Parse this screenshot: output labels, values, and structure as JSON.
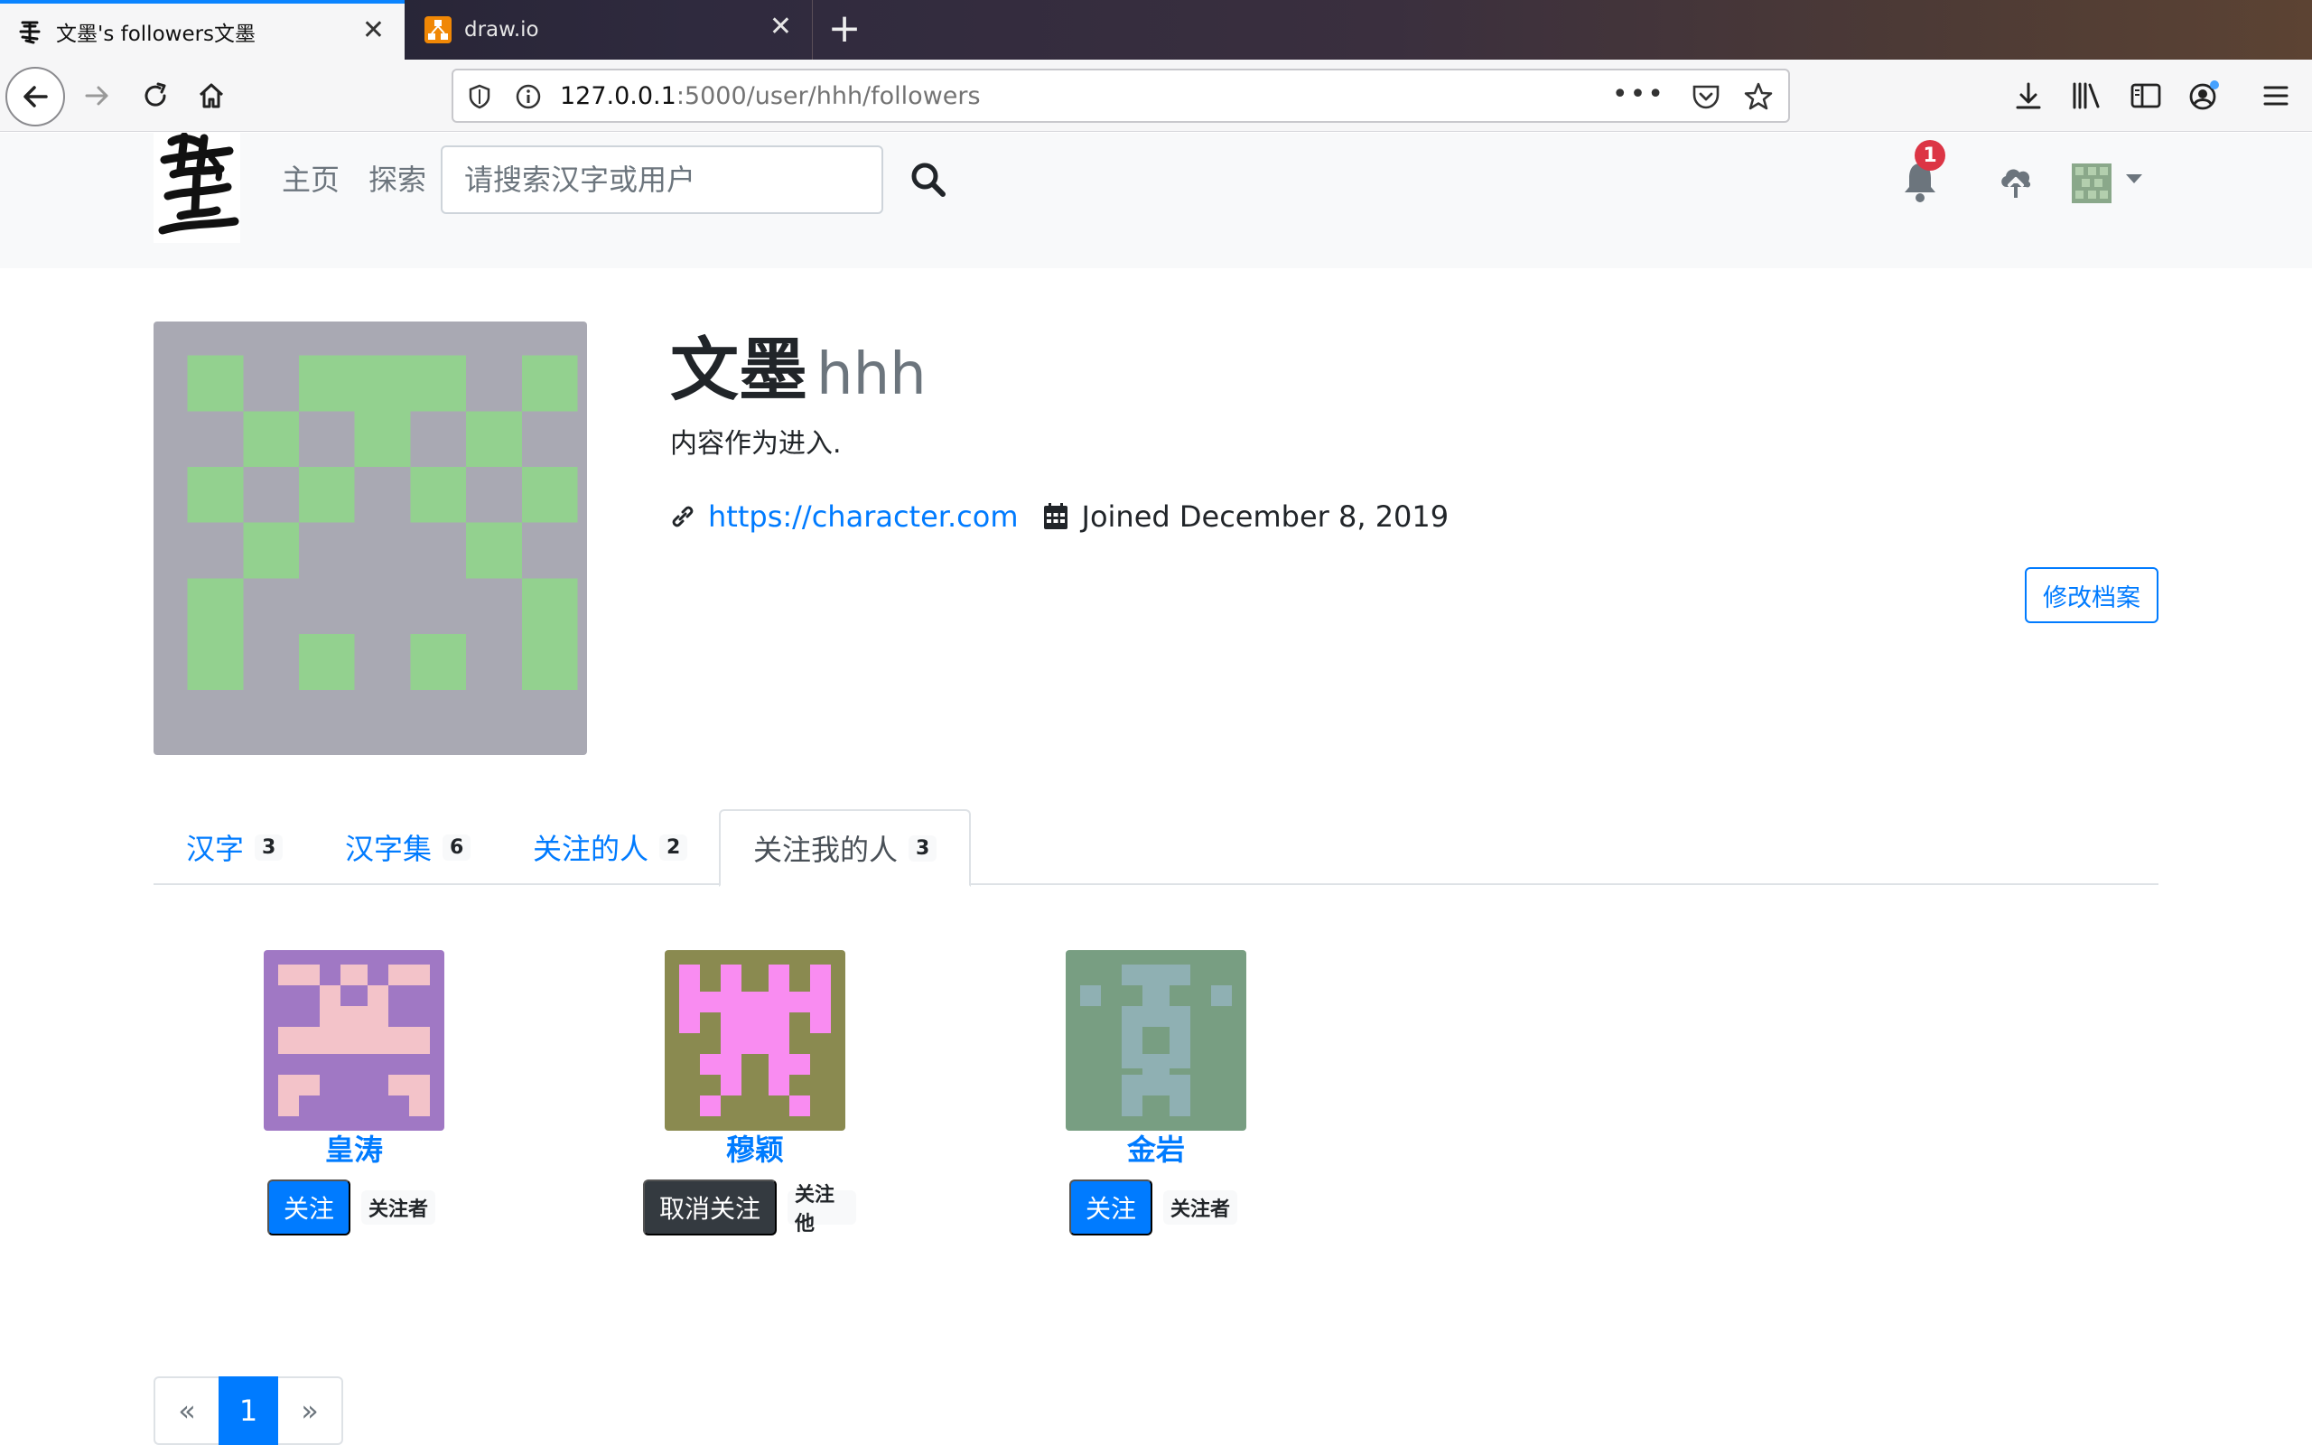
{
  "browser": {
    "tabs": [
      {
        "title": "文墨's followers文墨",
        "active": true,
        "favicon": "ink-brush-icon"
      },
      {
        "title": "draw.io",
        "active": false,
        "favicon": "drawio-icon"
      }
    ],
    "new_tab_symbol": "+",
    "url_host": "127.0.0.1",
    "url_rest": ":5000/user/hhh/followers",
    "more_symbol": "•••"
  },
  "site": {
    "nav": {
      "home": "主页",
      "explore": "探索"
    },
    "search_placeholder": "请搜索汉字或用户",
    "notification_count": "1"
  },
  "profile": {
    "name": "文墨",
    "username": "hhh",
    "bio": "内容作为进入.",
    "website": "https://character.com",
    "joined": "Joined December 8, 2019",
    "edit_label": "修改档案",
    "avatar_colors": {
      "bg": "#a9a9b3",
      "fg": "#93d18f"
    }
  },
  "tabs": [
    {
      "label": "汉字",
      "count": "3"
    },
    {
      "label": "汉字集",
      "count": "6"
    },
    {
      "label": "关注的人",
      "count": "2"
    },
    {
      "label": "关注我的人",
      "count": "3"
    }
  ],
  "followers": [
    {
      "name": "皇涛",
      "button": "关注",
      "button_style": "primary",
      "badge": "关注者",
      "bg": "#a078c4",
      "fg": "#f3c3c9"
    },
    {
      "name": "穆颖",
      "button": "取消关注",
      "button_style": "dark",
      "badge": "关注他",
      "bg": "#8a8a50",
      "fg": "#f98cf1"
    },
    {
      "name": "金岩",
      "button": "关注",
      "button_style": "primary",
      "badge": "关注者",
      "bg": "#789e82",
      "fg": "#8fb0b3"
    }
  ],
  "pagination": {
    "prev": "«",
    "current": "1",
    "next": "»"
  }
}
